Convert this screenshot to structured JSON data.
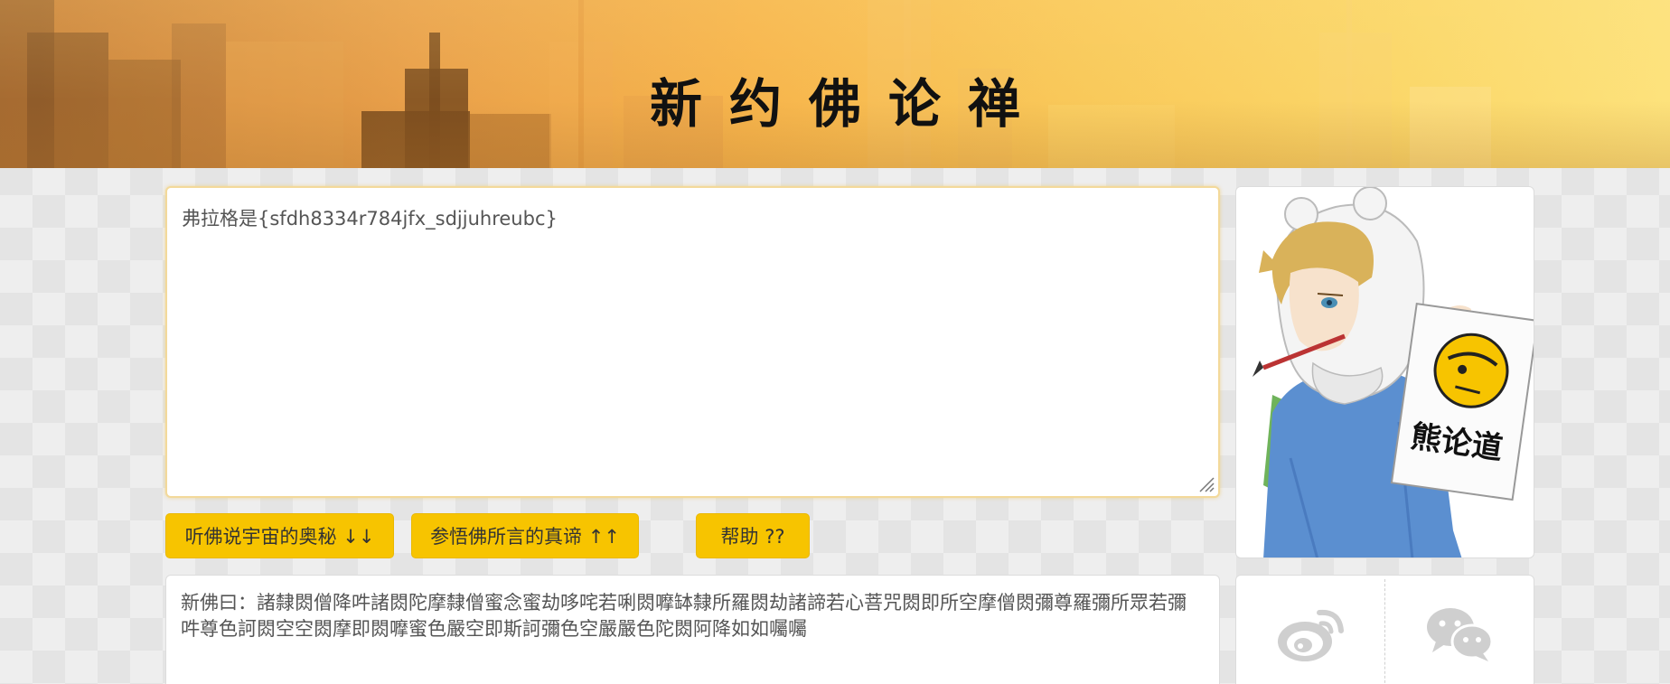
{
  "banner": {
    "title": "新约佛论禅"
  },
  "input": {
    "value": "弗拉格是{sfdh8334r784jfx_sdjjuhreubc}"
  },
  "buttons": {
    "encode_label": "听佛说宇宙的奥秘 ↓↓",
    "decode_label": "参悟佛所言的真谛 ↑↑",
    "help_label": "帮助 ??"
  },
  "output": {
    "text": "新佛曰：諸隸閦僧降吽諸閦陀摩隸僧蜜念蜜劫哆咤若唎閦嚤缽隸所羅閦劫諸諦若心菩咒閦即所空摩僧閦彌尊羅彌所眾若彌吽尊色訶閦空空閦摩即閦嚤蜜色嚴空即斯訶彌色空嚴嚴色陀閦阿降如如囑囑"
  },
  "side": {
    "sign_text": "熊论道"
  },
  "share": {
    "weibo_icon": "weibo-icon",
    "wechat_icon": "wechat-icon"
  },
  "colors": {
    "button": "#f7c400",
    "banner_start": "#c8813a",
    "banner_end": "#fde27c"
  }
}
